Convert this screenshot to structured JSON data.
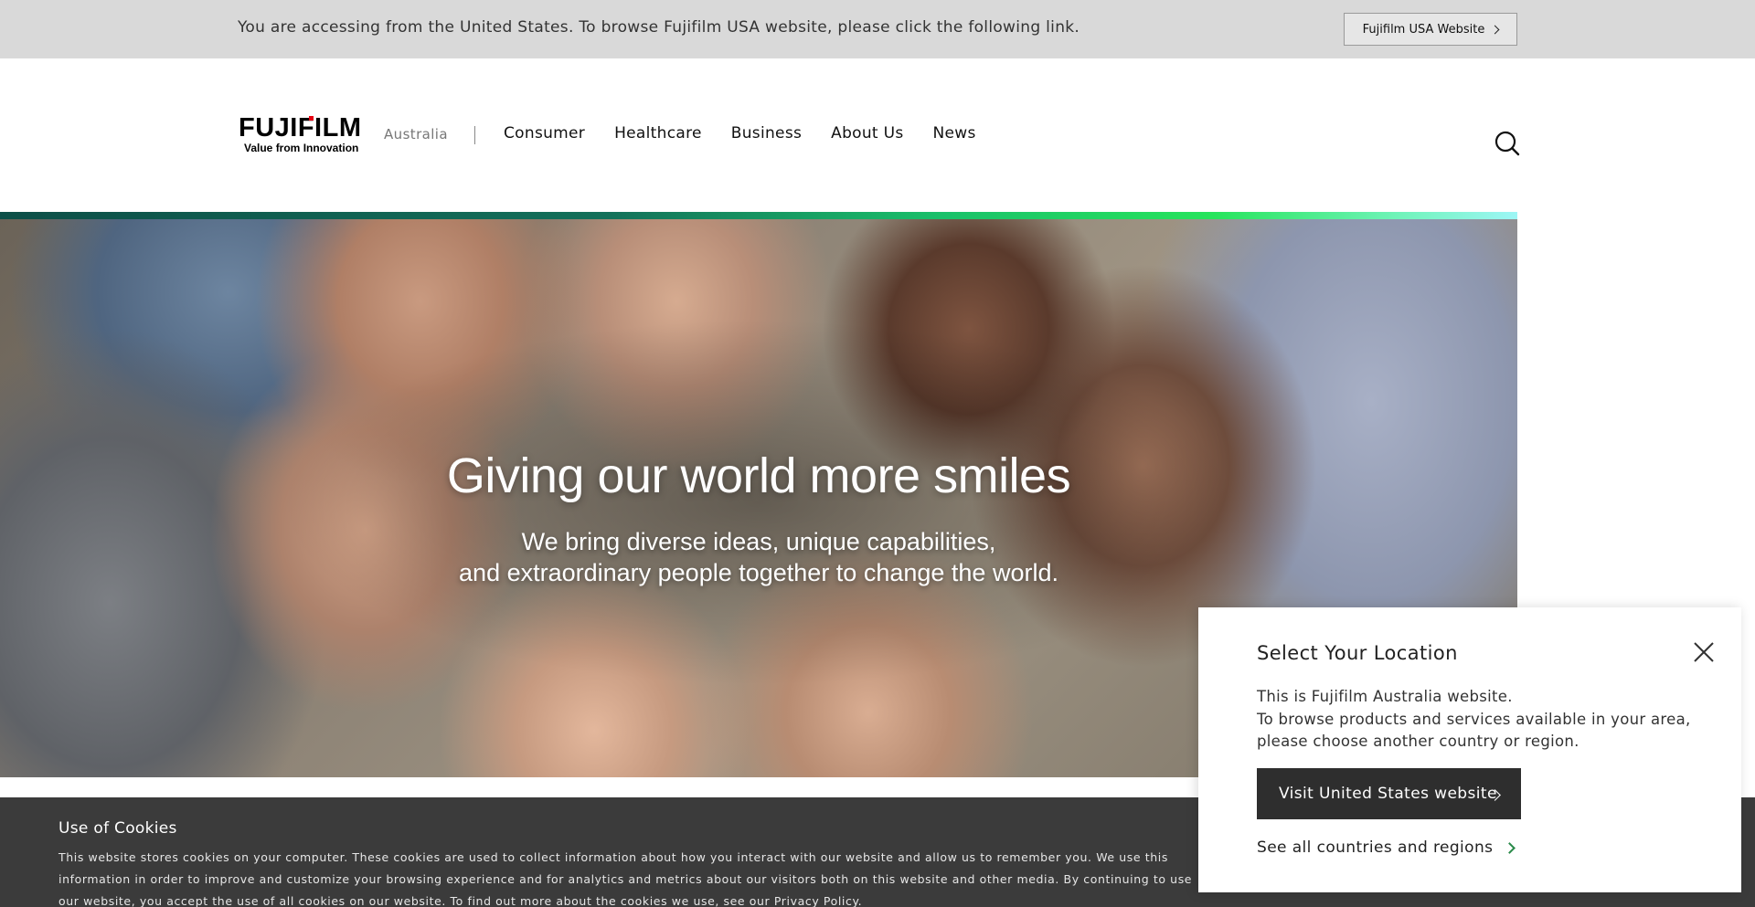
{
  "notice": {
    "text": "You are accessing from the United States. To browse Fujifilm USA website, please click the following link.",
    "button_label": "Fujifilm USA Website"
  },
  "header": {
    "logo_text": "FUJIFILM",
    "logo_tagline": "Value from Innovation",
    "region": "Australia",
    "nav": [
      "Consumer",
      "Healthcare",
      "Business",
      "About Us",
      "News"
    ],
    "search_icon": "search-icon"
  },
  "hero": {
    "title": "Giving our world more smiles",
    "subtitle_line1": "We bring diverse ideas, unique capabilities,",
    "subtitle_line2": "and extraordinary people together to change the world."
  },
  "cookies": {
    "title": "Use of Cookies",
    "text": "This website stores cookies on your computer. These cookies are used to collect information about how you interact with our website and allow us to remember you. We use this information in order to improve and customize your browsing experience and for analytics and metrics about our visitors both on this website and other media. By continuing to use our website, you accept the use of all cookies on our website. To find out more about the cookies we use, see our Privacy Policy."
  },
  "location_popup": {
    "title": "Select Your Location",
    "line1": "This is Fujifilm Australia website.",
    "line2": "To browse products and services available in your area,",
    "line3": "please choose another country or region.",
    "button_label": "Visit United States website",
    "link_label": "See all countries and regions",
    "close_icon": "close-icon"
  },
  "colors": {
    "brand_red": "#e60012",
    "link_green": "#2a8a4a",
    "notice_bg": "#d9d9d9",
    "cookie_bg": "#3b3b3b"
  }
}
